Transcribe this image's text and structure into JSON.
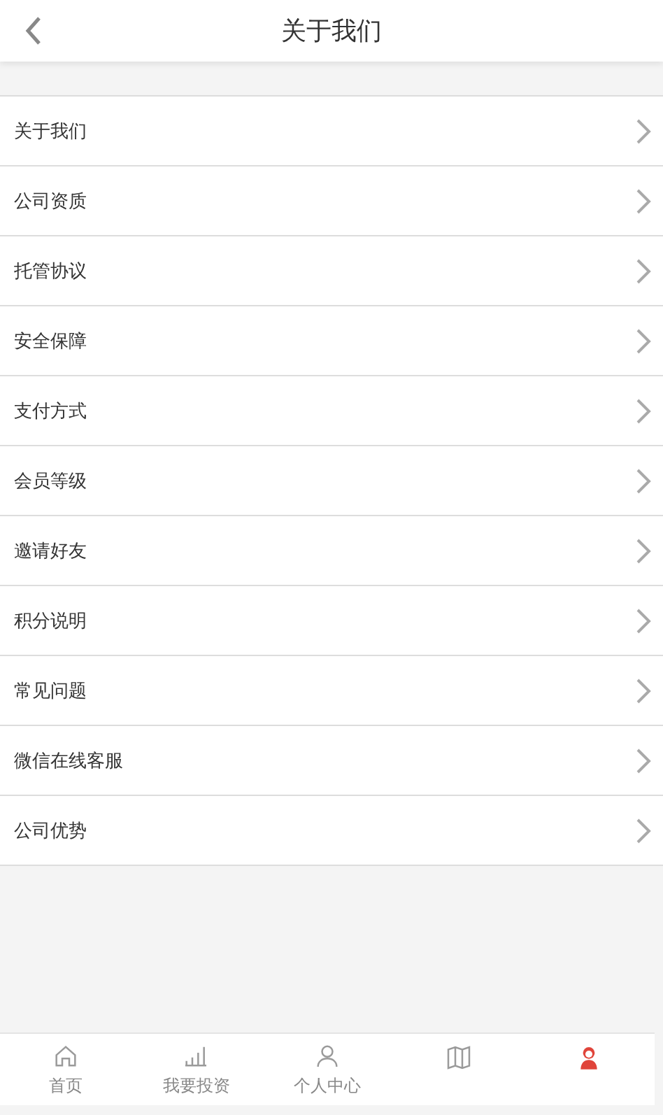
{
  "header": {
    "title": "关于我们"
  },
  "menu": [
    {
      "label": "关于我们"
    },
    {
      "label": "公司资质"
    },
    {
      "label": "托管协议"
    },
    {
      "label": "安全保障"
    },
    {
      "label": "支付方式"
    },
    {
      "label": "会员等级"
    },
    {
      "label": "邀请好友"
    },
    {
      "label": "积分说明"
    },
    {
      "label": "常见问题"
    },
    {
      "label": "微信在线客服"
    },
    {
      "label": "公司优势"
    }
  ],
  "tab_bar": [
    {
      "kind": "home",
      "label": "首页",
      "selected": false
    },
    {
      "kind": "bars",
      "label": "我要投资",
      "selected": false
    },
    {
      "kind": "person",
      "label": "个人中心",
      "selected": false
    },
    {
      "kind": "map",
      "selected": false
    },
    {
      "kind": "avatar",
      "selected": true
    }
  ]
}
